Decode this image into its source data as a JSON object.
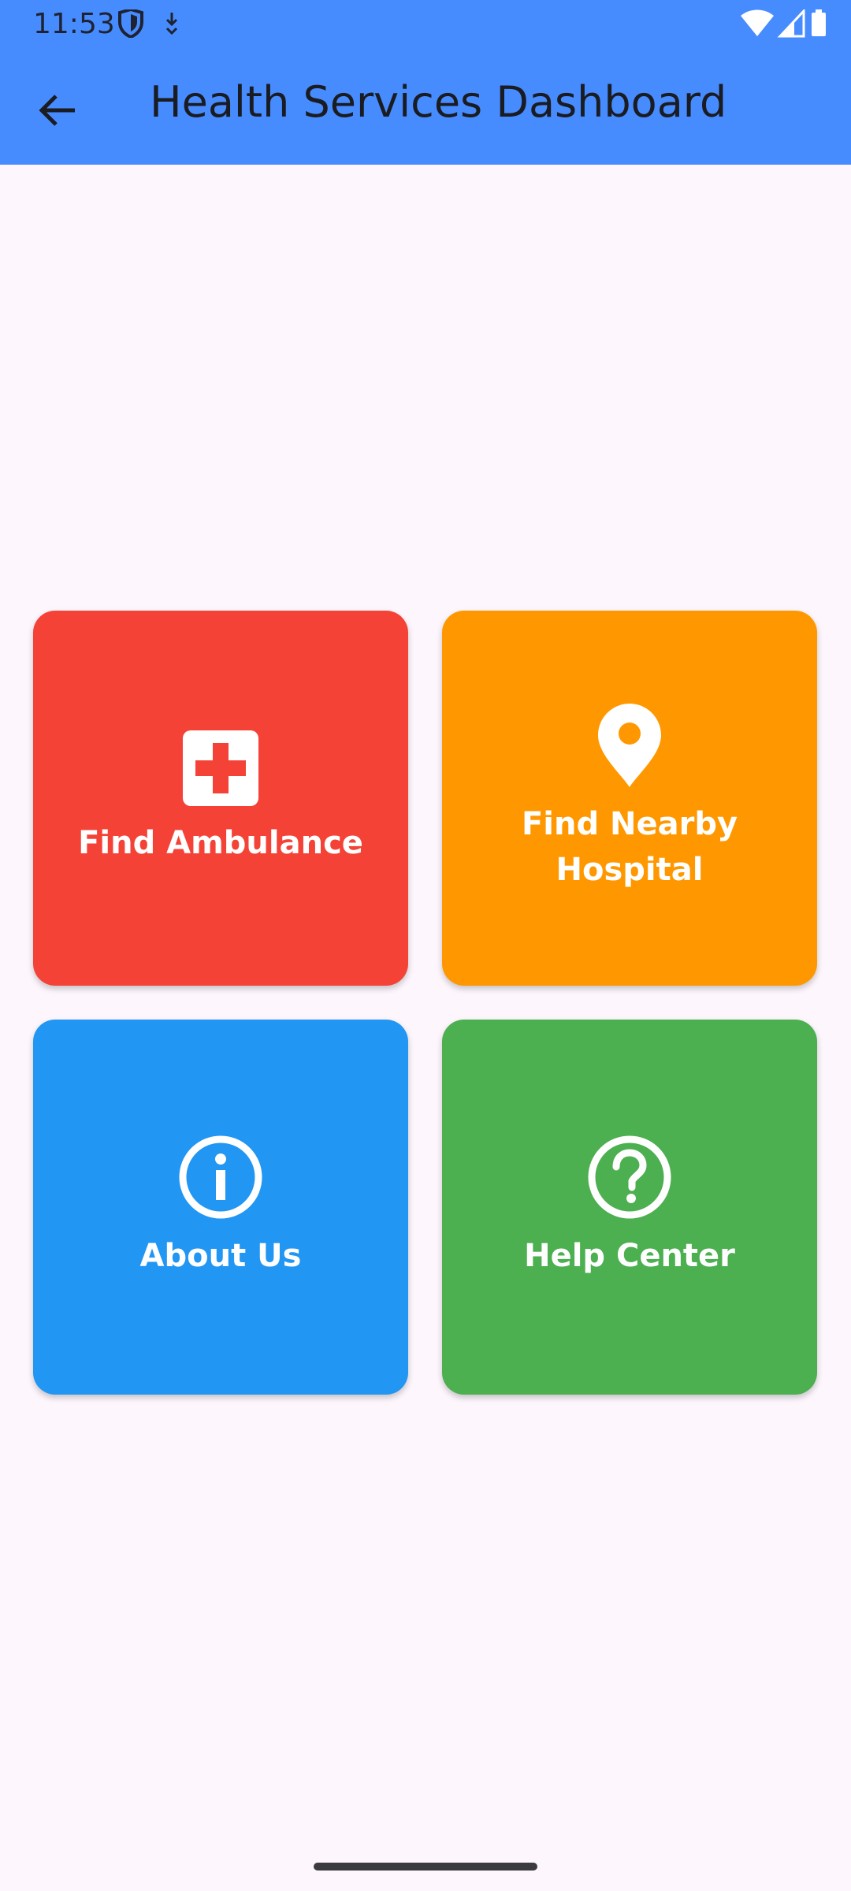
{
  "status_bar": {
    "time": "11:53"
  },
  "appbar": {
    "title": "Health Services Dashboard"
  },
  "tiles": [
    {
      "label": "Find Ambulance",
      "icon": "medical-cross-icon",
      "color": "#F44336"
    },
    {
      "label": "Find Nearby Hospital",
      "icon": "location-pin-icon",
      "color": "#FF9800"
    },
    {
      "label": "About Us",
      "icon": "info-icon",
      "color": "#2196F3"
    },
    {
      "label": "Help Center",
      "icon": "help-icon",
      "color": "#4CAF50"
    }
  ],
  "colors": {
    "appbar": "#478CFF",
    "background": "#FDF7FD"
  }
}
